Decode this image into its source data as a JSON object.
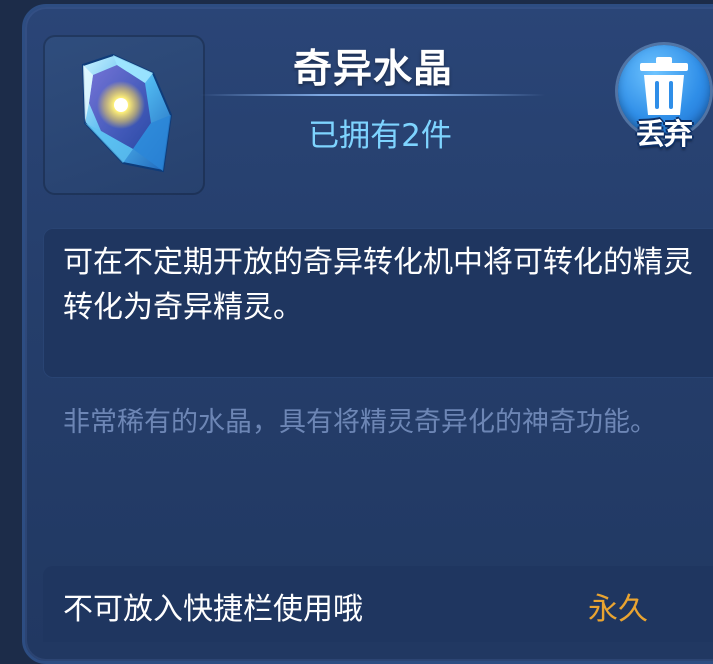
{
  "item": {
    "name": "奇异水晶",
    "owned_text": "已拥有2件",
    "icon": "crystal-icon"
  },
  "actions": {
    "discard_label": "丢弃",
    "discard_icon": "trash-can-icon"
  },
  "description": "可在不定期开放的奇异转化机中将可转化的精灵转化为奇异精灵。",
  "flavor_text": "非常稀有的水晶，具有将精灵奇异化的神奇功能。",
  "footer": {
    "note": "不可放入快捷栏使用哦",
    "duration": "永久"
  },
  "colors": {
    "panel": "#253e6b",
    "owned_text": "#7ed4ff",
    "flavor_text": "#6d86b5",
    "duration": "#e9a431",
    "discard_button": "#2f8ee8"
  }
}
